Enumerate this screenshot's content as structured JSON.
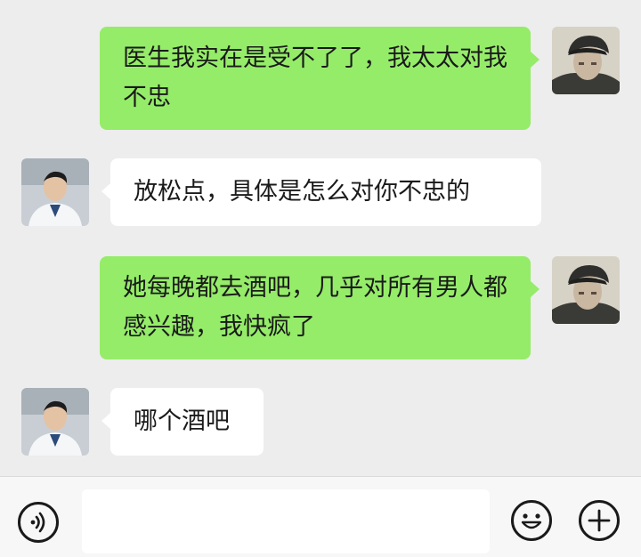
{
  "messages": [
    {
      "side": "out",
      "text": "医生我实在是受不了了，我太太对我不忠",
      "avatar": "user-avatar"
    },
    {
      "side": "in",
      "text": "放松点，具体是怎么对你不忠的",
      "avatar": "doctor-avatar"
    },
    {
      "side": "out",
      "text": "她每晚都去酒吧，几乎对所有男人都感兴趣，我快疯了",
      "avatar": "user-avatar"
    },
    {
      "side": "in",
      "text": "哪个酒吧",
      "avatar": "doctor-avatar"
    }
  ],
  "input": {
    "value": "",
    "placeholder": ""
  },
  "colors": {
    "outgoing_bubble": "#95ec69",
    "incoming_bubble": "#ffffff",
    "background": "#ededed"
  },
  "icons": {
    "voice": "voice-icon",
    "emoji": "emoji-icon",
    "more": "plus-icon"
  }
}
